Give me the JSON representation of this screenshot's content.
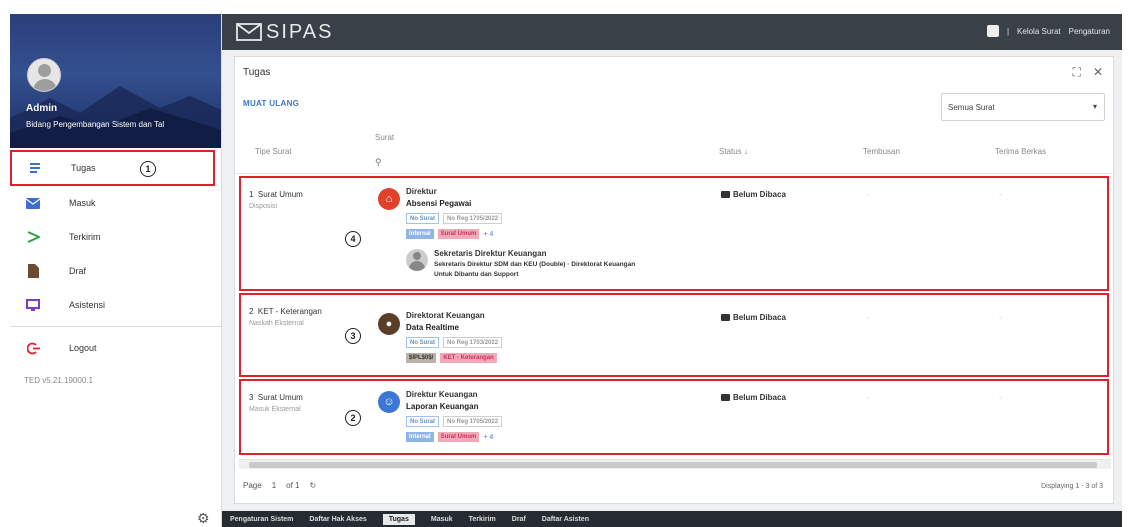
{
  "app": {
    "logo_text": "SIPAS"
  },
  "topbar": {
    "item_1": "Kelola Surat",
    "item_2": "Pengaturan",
    "separator": "|"
  },
  "user": {
    "name": "Admin",
    "department": "Bidang Pengembangan Sistem dan Tal"
  },
  "sidebar": {
    "items": [
      {
        "label": "Tugas",
        "icon": "list-icon",
        "color": "#3b6fd1"
      },
      {
        "label": "Masuk",
        "icon": "envelope-icon",
        "color": "#3b6fd1"
      },
      {
        "label": "Terkirim",
        "icon": "send-icon",
        "color": "#2ea043"
      },
      {
        "label": "Draf",
        "icon": "file-icon",
        "color": "#6b4a2f"
      },
      {
        "label": "Asistensi",
        "icon": "monitor-icon",
        "color": "#7a3cc0"
      }
    ],
    "logout_label": "Logout",
    "version": "TED v5.21.19000.1",
    "callout_active": "1"
  },
  "panel": {
    "title": "Tugas",
    "reload_label": "MUAT ULANG",
    "filter_value": "Semua Surat",
    "columns": {
      "type": "Tipe Surat",
      "letter": "Surat",
      "status": "Status",
      "cc": "Tembusan",
      "attachment": "Terima Berkas"
    }
  },
  "rows": [
    {
      "num": "1",
      "type": "Surat Umum",
      "type_sub": "Disposisi",
      "sender": "Direktur",
      "subject": "Absensi Pegawai",
      "chip_1": "No Surat",
      "chip_2": "No Reg 1705/2022",
      "tag_1": "Internal",
      "tag_2": "Surat Umum",
      "plus": "+ 4",
      "status": "Belum Dibaca",
      "cc": "-",
      "attach": "-",
      "callout": "4",
      "disposition": {
        "name": "Sekretaris Direktur Keuangan",
        "line": "Sekretaris Direktur SDM dan KEU (Double) · Direktorat Keuangan",
        "note": "Untuk Dibantu dan Support"
      }
    },
    {
      "num": "2",
      "type": "KET - Keterangan",
      "type_sub": "Naskah Eksternal",
      "sender": "Direktorat Keuangan",
      "subject": "Data Realtime",
      "chip_1": "No Surat",
      "chip_2": "No Reg 1703/2022",
      "tag_1": "$IPL$0$/",
      "tag_2": "KET - Keterangan",
      "plus": "",
      "status": "Belum Dibaca",
      "cc": "-",
      "attach": "-",
      "callout": "3"
    },
    {
      "num": "3",
      "type": "Surat Umum",
      "type_sub": "Masuk Eksternal",
      "sender": "Direktur Keuangan",
      "subject": "Laporan Keuangan",
      "chip_1": "No Surat",
      "chip_2": "No Reg 1705/2022",
      "tag_1": "Internal",
      "tag_2": "Surat Umum",
      "plus": "+ 4",
      "status": "Belum Dibaca",
      "cc": "-",
      "attach": "-",
      "callout": "2"
    }
  ],
  "pager": {
    "page_label": "Page",
    "page": "1",
    "of": "of 1",
    "displaying": "Displaying 1 - 3 of 3"
  },
  "taskbar": [
    "Pengaturan Sistem",
    "Daftar Hak Akses",
    "Tugas",
    "Masuk",
    "Terkirim",
    "Draf",
    "Daftar Asisten"
  ],
  "taskbar_active": "Tugas"
}
